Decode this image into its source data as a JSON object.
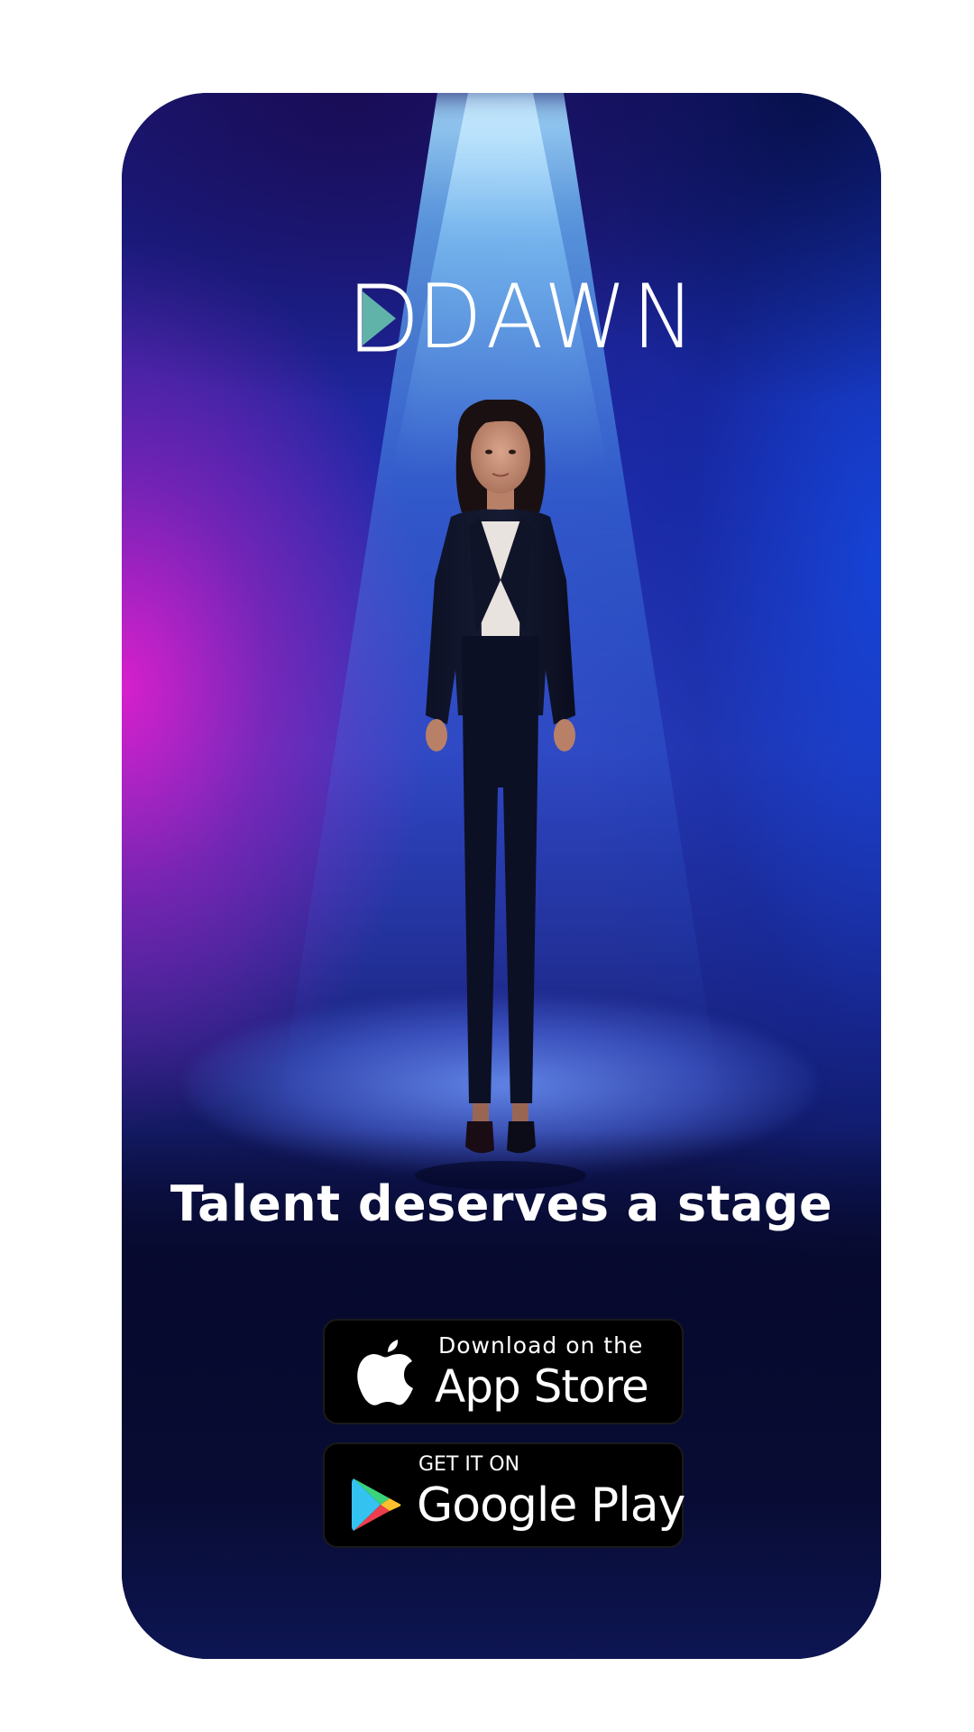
{
  "brand": {
    "name": "DAWN",
    "colors": {
      "logo_mark_teal": "#5fb3a8",
      "logo_text": "#ffffff",
      "background_magenta": "#d81fcb",
      "background_blue": "#1e3ad0",
      "spotlight": "#9fd8ff",
      "button_bg": "#000000"
    }
  },
  "hero": {
    "tagline": "Talent deserves a stage"
  },
  "store_buttons": {
    "app_store": {
      "icon": "apple-icon",
      "small_label": "Download on the",
      "big_label": "App Store"
    },
    "google_play": {
      "icon": "google-play-icon",
      "small_label": "GET IT ON",
      "big_label": "Google Play"
    }
  }
}
